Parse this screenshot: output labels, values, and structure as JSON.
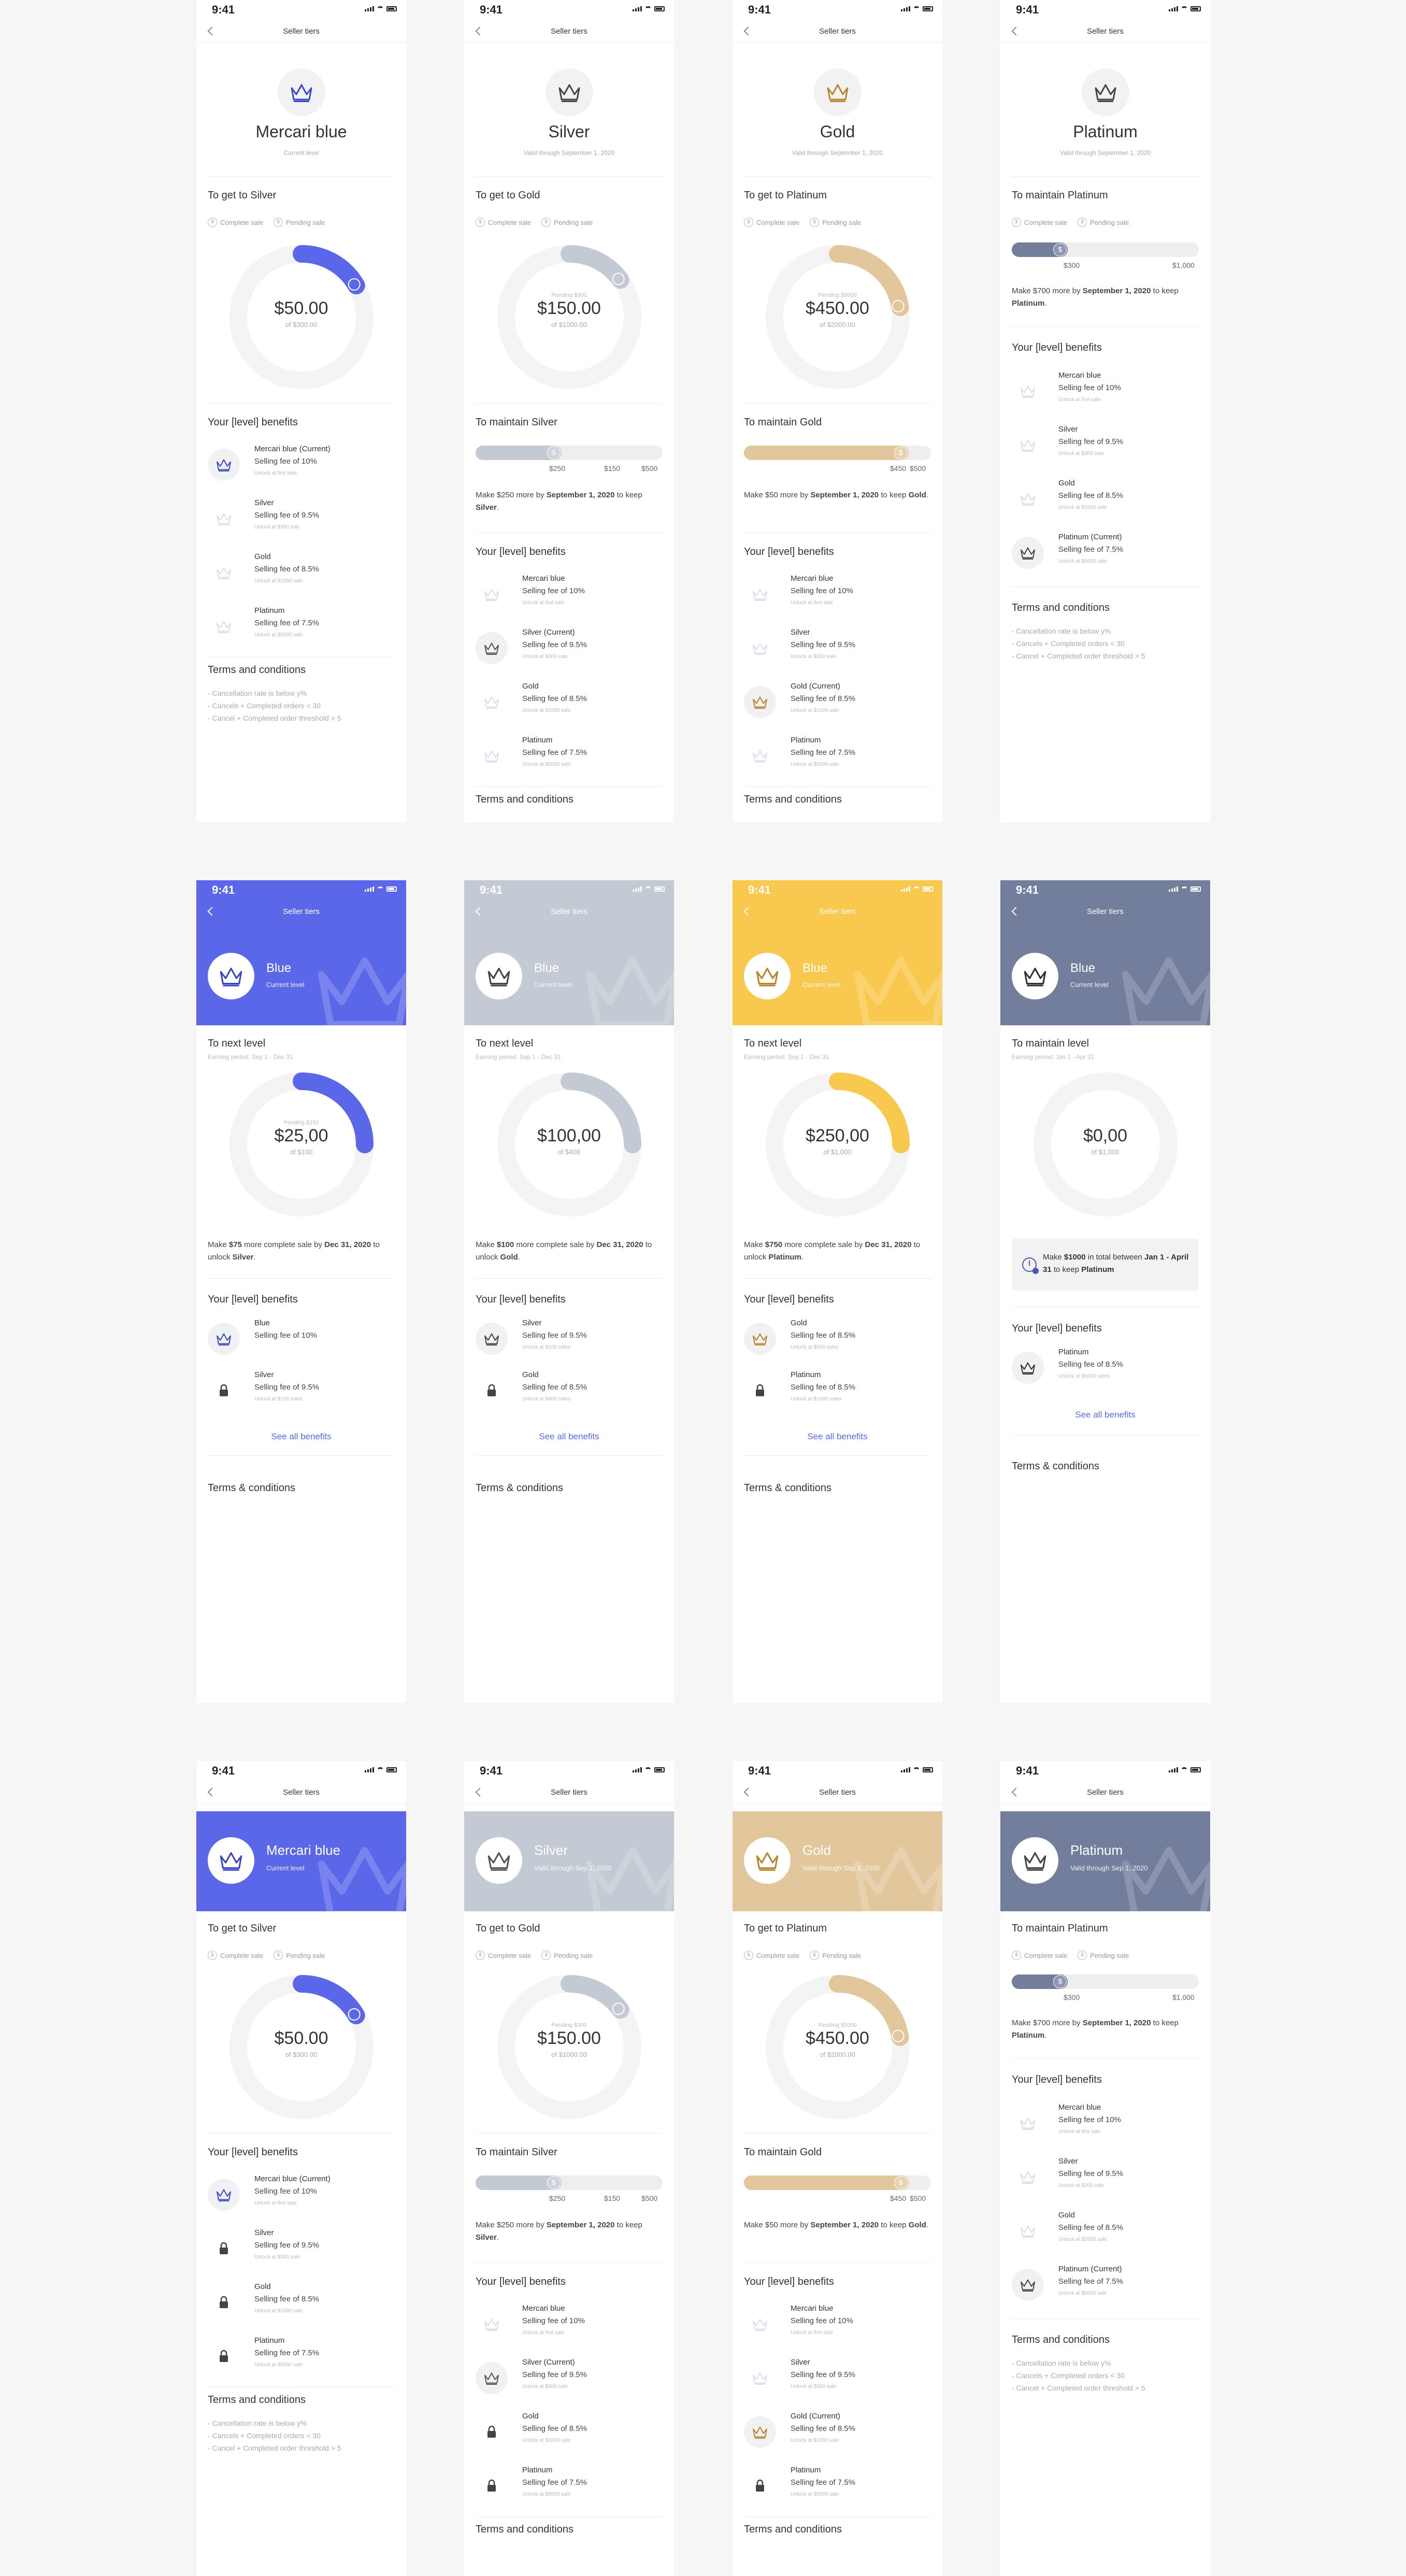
{
  "status_time": "9:41",
  "nav_title": "Seller tiers",
  "colors": {
    "blue": "#5b67e9",
    "silver": "#c3cad3",
    "gold": "#e2c79c",
    "gold_bright": "#f9c84f",
    "platinum": "#737e9d",
    "track": "#f4f4f4"
  },
  "icons": [
    "crown-icon",
    "lock-icon",
    "back-chevron-icon",
    "dollar-icon",
    "clock-icon"
  ],
  "row1": [
    {
      "tier": "Mercari blue",
      "subtitle": "Current level",
      "goal_title": "To get to Silver",
      "legend": [
        "Complete sale",
        "Pending sale"
      ],
      "ring": {
        "pending": "",
        "amount": "$50.00",
        "of": "of $300.00",
        "fraction": 0.1667
      },
      "benefits_title": "Your [level] benefits",
      "benefits": [
        {
          "name": "Mercari blue (Current)",
          "fee": "Selling fee of 10%",
          "unlock": "Unlock at first sale"
        },
        {
          "name": "Silver",
          "fee": "Selling fee of 9.5%",
          "unlock": "Unlock at $300 sale"
        },
        {
          "name": "Gold",
          "fee": "Selling fee of 8.5%",
          "unlock": "Unlock at $1000 sale"
        },
        {
          "name": "Platinum",
          "fee": "Selling fee of 7.5%",
          "unlock": "Unlock at $5000 sale"
        }
      ],
      "terms_title": "Terms and conditions",
      "terms": [
        "- Cancellation rate is below y%",
        "- Cancels + Completed orders < 30",
        "- Cancel + Completed order threshold > 5"
      ]
    },
    {
      "tier": "Silver",
      "subtitle": "Valid through September 1, 2020",
      "goal_title": "To get to Gold",
      "legend": [
        "Complete sale",
        "Pending sale"
      ],
      "ring": {
        "pending": "Pending $300",
        "amount": "$150.00",
        "of": "of $1000.00",
        "fraction": 0.15
      },
      "maintain_title": "To maintain Silver",
      "maintain_labels": [
        "$250",
        "$150",
        "$500"
      ],
      "maintain_text": [
        "Make $250 more by ",
        "September 1, 2020",
        " to keep ",
        "Silver",
        "."
      ],
      "benefits_title": "Your [level] benefits",
      "benefits": [
        {
          "name": "Mercari blue",
          "fee": "Selling fee of 10%",
          "unlock": "Unlock at first sale"
        },
        {
          "name": "Silver (Current)",
          "fee": "Selling fee of 9.5%",
          "unlock": "Unlock at $300 sale"
        },
        {
          "name": "Gold",
          "fee": "Selling fee of 8.5%",
          "unlock": "Unlock at $1000 sale"
        },
        {
          "name": "Platinum",
          "fee": "Selling fee of 7.5%",
          "unlock": "Unlock at $5000 sale"
        }
      ],
      "terms_title": "Terms and conditions"
    },
    {
      "tier": "Gold",
      "subtitle": "Valid through September 1, 2020",
      "goal_title": "To get to Platinum",
      "legend": [
        "Complete sale",
        "Pending sale"
      ],
      "ring": {
        "pending": "Pending $5000",
        "amount": "$450.00",
        "of": "of $2000.00",
        "fraction": 0.225
      },
      "maintain_title": "To maintain Gold",
      "maintain_labels": [
        "$450",
        "$500"
      ],
      "maintain_text": [
        "Make $50 more by ",
        "September 1, 2020",
        " to keep ",
        "Gold",
        "."
      ],
      "benefits_title": "Your [level] benefits",
      "benefits": [
        {
          "name": "Mercari blue",
          "fee": "Selling fee of 10%",
          "unlock": "Unlock at first sale"
        },
        {
          "name": "Silver",
          "fee": "Selling fee of 9.5%",
          "unlock": "Unlock at $300 sale"
        },
        {
          "name": "Gold (Current)",
          "fee": "Selling fee of 8.5%",
          "unlock": "Unlock at $1000 sale"
        },
        {
          "name": "Platinum",
          "fee": "Selling fee of 7.5%",
          "unlock": "Unlock at $5000 sale"
        }
      ],
      "terms_title": "Terms and conditions"
    },
    {
      "tier": "Platinum",
      "subtitle": "Valid through September 1, 2020",
      "goal_title": "To maintain Platinum",
      "legend": [
        "Complete sale",
        "Pending sale"
      ],
      "progress_labels": [
        "$300",
        "$1,000"
      ],
      "progress_fraction": 0.3,
      "maintain_text": [
        "Make $700 more by ",
        "September 1, 2020",
        " to keep ",
        "Platinum",
        "."
      ],
      "benefits_title": "Your [level] benefits",
      "benefits": [
        {
          "name": "Mercari blue",
          "fee": "Selling fee of 10%",
          "unlock": "Unlock at first sale"
        },
        {
          "name": "Silver",
          "fee": "Selling fee of 9.5%",
          "unlock": "Unlock at $300 sale"
        },
        {
          "name": "Gold",
          "fee": "Selling fee of 8.5%",
          "unlock": "Unlock at $1000 sale"
        },
        {
          "name": "Platinum (Current)",
          "fee": "Selling fee of 7.5%",
          "unlock": "Unlock at $5000 sale"
        }
      ],
      "terms_title": "Terms and conditions",
      "terms": [
        "- Cancellation rate is below y%",
        "- Cancels + Completed orders < 30",
        "- Cancel + Completed order threshold > 5"
      ]
    }
  ],
  "row2": [
    {
      "hero_title": "Blue",
      "hero_sub": "Current level",
      "goal_title": "To next level",
      "period": "Earning period: Sep 1 - Dec 31",
      "ring": {
        "pending": "Pending $150",
        "amount": "$25,00",
        "of": "of $100",
        "fraction": 0.25
      },
      "message": [
        "Make ",
        "$75",
        " more complete sale by ",
        "Dec 31, 2020",
        " to unlock ",
        "Silver",
        "."
      ],
      "benefits_title": "Your [level] benefits",
      "benefits": [
        {
          "name": "Blue",
          "fee": "Selling fee of 10%",
          "unlock": ""
        },
        {
          "name": "Silver",
          "fee": "Selling fee of 9.5%",
          "unlock": "Unlock at $100 sales"
        }
      ],
      "see_all": "See all benefits",
      "terms_title": "Terms & conditions"
    },
    {
      "hero_title": "Blue",
      "hero_sub": "Current level",
      "goal_title": "To next level",
      "period": "Earning period: Sep 1 - Dec 31",
      "ring": {
        "pending": "",
        "amount": "$100,00",
        "of": "of $400",
        "fraction": 0.25
      },
      "message": [
        "Make ",
        "$100",
        " more complete sale by ",
        "Dec 31, 2020",
        " to unlock ",
        "Gold",
        "."
      ],
      "benefits_title": "Your [level] benefits",
      "benefits": [
        {
          "name": "Silver",
          "fee": "Selling fee of 9.5%",
          "unlock": "Unlock at $100 sales"
        },
        {
          "name": "Gold",
          "fee": "Selling fee of 8.5%",
          "unlock": "Unlock at $400 sales"
        }
      ],
      "see_all": "See all benefits",
      "terms_title": "Terms & conditions"
    },
    {
      "hero_title": "Blue",
      "hero_sub": "Current level",
      "goal_title": "To next level",
      "period": "Earning period: Sep 1 - Dec 31",
      "ring": {
        "pending": "",
        "amount": "$250,00",
        "of": "of $1,000",
        "fraction": 0.25
      },
      "message": [
        "Make ",
        "$750",
        " more complete sale by ",
        "Dec 31, 2020",
        " to unlock ",
        "Platinum",
        "."
      ],
      "benefits_title": "Your [level] benefits",
      "benefits": [
        {
          "name": "Gold",
          "fee": "Selling fee of 8.5%",
          "unlock": "Unlock at $400 sales"
        },
        {
          "name": "Platinum",
          "fee": "Selling fee of 8.5%",
          "unlock": "Unlock at $1000 sales"
        }
      ],
      "see_all": "See all benefits",
      "terms_title": "Terms & conditions"
    },
    {
      "hero_title": "Blue",
      "hero_sub": "Current level",
      "goal_title": "To maintain level",
      "period": "Earning period: Jan 1 - Apr 31",
      "ring": {
        "pending": "",
        "amount": "$0,00",
        "of": "of $1,000",
        "fraction": 0
      },
      "info": [
        "Make ",
        "$1000",
        " in total between ",
        "Jan 1 - April 31",
        " to keep ",
        "Platinum"
      ],
      "benefits_title": "Your [level] benefits",
      "benefits": [
        {
          "name": "Platinum",
          "fee": "Selling fee of 8.5%",
          "unlock": "Unlock at $5000 sales"
        }
      ],
      "see_all": "See all benefits",
      "terms_title": "Terms & conditions"
    }
  ],
  "row3": [
    {
      "tier": "Mercari blue",
      "subtitle": "Current level",
      "goal_title": "To get to Silver",
      "legend": [
        "Complete sale",
        "Pending sale"
      ],
      "ring": {
        "pending": "",
        "amount": "$50.00",
        "of": "of $300.00",
        "fraction": 0.1667
      },
      "benefits_title": "Your [level] benefits",
      "benefits": [
        {
          "name": "Mercari blue (Current)",
          "fee": "Selling fee of 10%",
          "unlock": "Unlock at first sale"
        },
        {
          "name": "Silver",
          "fee": "Selling fee of 9.5%",
          "unlock": "Unlock at $300 sale"
        },
        {
          "name": "Gold",
          "fee": "Selling fee of 8.5%",
          "unlock": "Unlock at $1000 sale"
        },
        {
          "name": "Platinum",
          "fee": "Selling fee of 7.5%",
          "unlock": "Unlock at $5000 sale"
        }
      ],
      "terms_title": "Terms and conditions",
      "terms": [
        "- Cancellation rate is below y%",
        "- Cancels + Completed orders < 30",
        "- Cancel + Completed order threshold > 5"
      ]
    },
    {
      "tier": "Silver",
      "subtitle": "Valid through Sep 1, 2020",
      "goal_title": "To get to Gold",
      "legend": [
        "Complete sale",
        "Pending sale"
      ],
      "ring": {
        "pending": "Pending $300",
        "amount": "$150.00",
        "of": "of $1000.00",
        "fraction": 0.15
      },
      "maintain_title": "To maintain Silver",
      "maintain_labels": [
        "$250",
        "$150",
        "$500"
      ],
      "maintain_text": [
        "Make $250 more by ",
        "September 1, 2020",
        " to keep ",
        "Silver",
        "."
      ],
      "benefits_title": "Your [level] benefits",
      "benefits": [
        {
          "name": "Mercari blue",
          "fee": "Selling fee of 10%",
          "unlock": "Unlock at first sale"
        },
        {
          "name": "Silver (Current)",
          "fee": "Selling fee of 9.5%",
          "unlock": "Unlock at $300 sale"
        },
        {
          "name": "Gold",
          "fee": "Selling fee of 8.5%",
          "unlock": "Unlock at $1000 sale"
        },
        {
          "name": "Platinum",
          "fee": "Selling fee of 7.5%",
          "unlock": "Unlock at $5000 sale"
        }
      ],
      "terms_title": "Terms and conditions"
    },
    {
      "tier": "Gold",
      "subtitle": "Valid through Sep 1, 2020",
      "goal_title": "To get to Platinum",
      "legend": [
        "Complete sale",
        "Pending sale"
      ],
      "ring": {
        "pending": "Pending $5000",
        "amount": "$450.00",
        "of": "of $2000.00",
        "fraction": 0.225
      },
      "maintain_title": "To maintain Gold",
      "maintain_labels": [
        "$450",
        "$500"
      ],
      "maintain_text": [
        "Make $50 more by ",
        "September 1, 2020",
        " to keep ",
        "Gold",
        "."
      ],
      "benefits_title": "Your [level] benefits",
      "benefits": [
        {
          "name": "Mercari blue",
          "fee": "Selling fee of 10%",
          "unlock": "Unlock at first sale"
        },
        {
          "name": "Silver",
          "fee": "Selling fee of 9.5%",
          "unlock": "Unlock at $300 sale"
        },
        {
          "name": "Gold (Current)",
          "fee": "Selling fee of 8.5%",
          "unlock": "Unlock at $1000 sale"
        },
        {
          "name": "Platinum",
          "fee": "Selling fee of 7.5%",
          "unlock": "Unlock at $5000 sale"
        }
      ],
      "terms_title": "Terms and conditions"
    },
    {
      "tier": "Platinum",
      "subtitle": "Valid through Sep 1, 2020",
      "goal_title": "To maintain Platinum",
      "legend": [
        "Complete sale",
        "Pending sale"
      ],
      "progress_labels": [
        "$300",
        "$1,000"
      ],
      "progress_fraction": 0.3,
      "maintain_text": [
        "Make $700 more by ",
        "September 1, 2020",
        " to keep ",
        "Platinum",
        "."
      ],
      "benefits_title": "Your [level] benefits",
      "benefits": [
        {
          "name": "Mercari blue",
          "fee": "Selling fee of 10%",
          "unlock": "Unlock at first sale"
        },
        {
          "name": "Silver",
          "fee": "Selling fee of 9.5%",
          "unlock": "Unlock at $300 sale"
        },
        {
          "name": "Gold",
          "fee": "Selling fee of 8.5%",
          "unlock": "Unlock at $1000 sale"
        },
        {
          "name": "Platinum (Current)",
          "fee": "Selling fee of 7.5%",
          "unlock": "Unlock at $5000 sale"
        }
      ],
      "terms_title": "Terms and conditions",
      "terms": [
        "- Cancellation rate is below y%",
        "- Cancels + Completed orders < 30",
        "- Cancel + Completed order threshold > 5"
      ]
    }
  ]
}
